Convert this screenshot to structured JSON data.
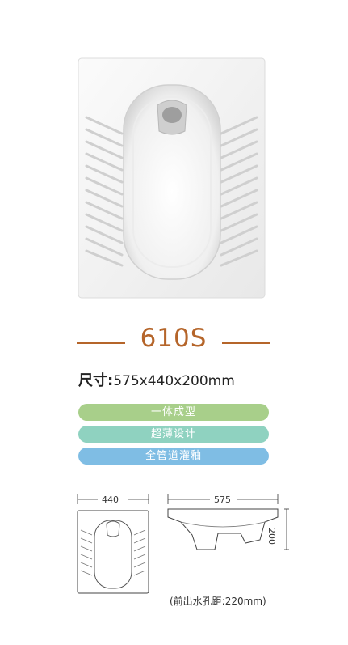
{
  "product": {
    "model": "610S",
    "size_label": "尺寸:",
    "size_value": "575x440x200mm"
  },
  "features": [
    {
      "label": "一体成型",
      "color": "#a8cf8a"
    },
    {
      "label": "超薄设计",
      "color": "#8fd2c0"
    },
    {
      "label": "全管道灌釉",
      "color": "#7fbde4"
    }
  ],
  "diagram": {
    "width_label": "440",
    "length_label": "575",
    "height_label": "200",
    "note": "(前出水孔距:220mm)"
  },
  "colors": {
    "accent": "#b5652a"
  }
}
